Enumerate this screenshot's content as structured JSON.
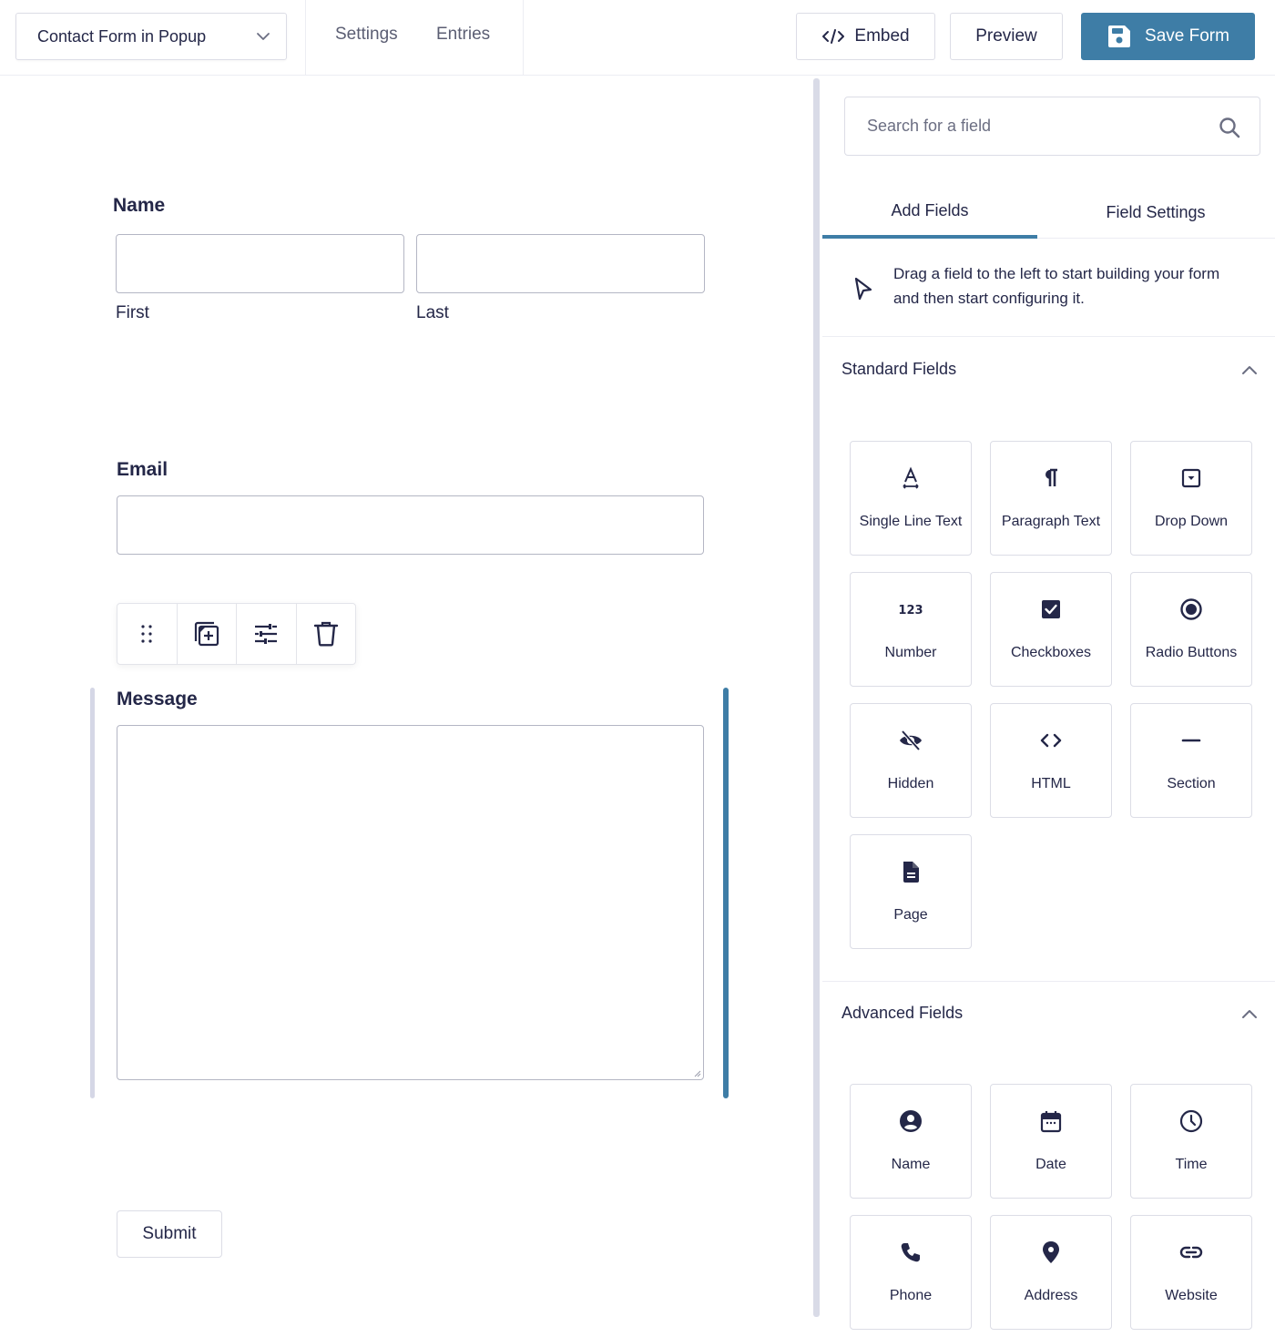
{
  "header": {
    "form_selector": {
      "value": "Contact Form in Popup",
      "icon": "chevron-down-icon"
    },
    "nav": [
      {
        "label": "Settings"
      },
      {
        "label": "Entries"
      }
    ],
    "buttons": {
      "embed": {
        "label": "Embed",
        "icon": "code-icon"
      },
      "preview": {
        "label": "Preview"
      },
      "save": {
        "label": "Save Form",
        "icon": "floppy-disk-icon"
      }
    }
  },
  "colors": {
    "accent": "#3e7da6",
    "text": "#242748",
    "border": "#dcdde6",
    "selection_bar": "#d5d7e6"
  },
  "form": {
    "fields": {
      "name": {
        "label": "Name",
        "first_sub_label": "First",
        "last_sub_label": "Last",
        "first_value": "",
        "last_value": ""
      },
      "email": {
        "label": "Email",
        "value": ""
      },
      "message": {
        "label": "Message",
        "value": "",
        "selected": true
      }
    },
    "field_toolbar": [
      {
        "name": "drag-handle",
        "icon": "drag-dots-icon"
      },
      {
        "name": "duplicate",
        "icon": "duplicate-icon"
      },
      {
        "name": "settings",
        "icon": "sliders-icon"
      },
      {
        "name": "delete",
        "icon": "trash-icon"
      }
    ],
    "submit_label": "Submit"
  },
  "sidebar": {
    "search": {
      "placeholder": "Search for a field",
      "value": ""
    },
    "tabs": [
      {
        "label": "Add Fields",
        "active": true
      },
      {
        "label": "Field Settings",
        "active": false
      }
    ],
    "hint": "Drag a field to the left to start building your form and then start configuring it.",
    "sections": [
      {
        "title": "Standard Fields",
        "expanded": true,
        "fields": [
          {
            "label": "Single Line Text",
            "icon": "text-icon"
          },
          {
            "label": "Paragraph Text",
            "icon": "paragraph-icon"
          },
          {
            "label": "Drop Down",
            "icon": "dropdown-icon"
          },
          {
            "label": "Number",
            "icon": "number-icon"
          },
          {
            "label": "Checkboxes",
            "icon": "checkbox-icon"
          },
          {
            "label": "Radio Buttons",
            "icon": "radio-icon"
          },
          {
            "label": "Hidden",
            "icon": "eye-slash-icon"
          },
          {
            "label": "HTML",
            "icon": "code-icon"
          },
          {
            "label": "Section",
            "icon": "minus-icon"
          },
          {
            "label": "Page",
            "icon": "document-icon"
          }
        ]
      },
      {
        "title": "Advanced Fields",
        "expanded": true,
        "fields": [
          {
            "label": "Name",
            "icon": "user-circle-icon"
          },
          {
            "label": "Date",
            "icon": "calendar-icon"
          },
          {
            "label": "Time",
            "icon": "clock-icon"
          },
          {
            "label": "Phone",
            "icon": "phone-icon"
          },
          {
            "label": "Address",
            "icon": "map-pin-icon"
          },
          {
            "label": "Website",
            "icon": "link-icon"
          }
        ]
      }
    ]
  }
}
